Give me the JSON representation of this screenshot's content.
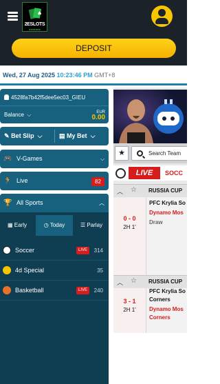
{
  "header": {
    "logo_text": "2ESLOTS",
    "deposit_label": "DEPOSIT"
  },
  "datebar": {
    "date": "Wed, 27 Aug 2025",
    "time": "10:23:46 PM",
    "tz": "GMT+8"
  },
  "account": {
    "id": "4528fa7b42f5dee5ec03_GIEU",
    "balance_label": "Balance",
    "currency": "EUR",
    "amount": "0.00"
  },
  "bets": {
    "bet_slip": "Bet Slip",
    "my_bet": "My Bet"
  },
  "nav": {
    "vgames": "V-Games",
    "live": "Live",
    "live_count": "82",
    "all_sports": "All Sports"
  },
  "tabs": [
    "Early",
    "Today",
    "Parlay"
  ],
  "sports": [
    {
      "name": "Soccer",
      "live": "LIVE",
      "count": "314"
    },
    {
      "name": "4d Special",
      "live": "",
      "count": "35"
    },
    {
      "name": "Basketball",
      "live": "LIVE",
      "count": "240"
    }
  ],
  "right": {
    "search_placeholder": "Search Team",
    "live_tag": "LIVE",
    "live_sport": "SOCC"
  },
  "matches": [
    {
      "competition": "RUSSIA CUP",
      "score": "0 - 0",
      "minute": "2H 1'",
      "home": "PFC Krylia So",
      "away": "Dynamo Mos",
      "draw": "Draw"
    },
    {
      "competition": "RUSSIA CUP",
      "score": "3 - 1",
      "minute": "2H 1'",
      "home": "PFC Krylia So",
      "home2": "Corners",
      "away": "Dynamo Mos",
      "away2": "Corners"
    }
  ],
  "colors": {
    "header_bg": "#1b2229",
    "panel_blue": "#17617f",
    "accent_yellow": "#f7c600",
    "live_red": "#d71c1c"
  }
}
